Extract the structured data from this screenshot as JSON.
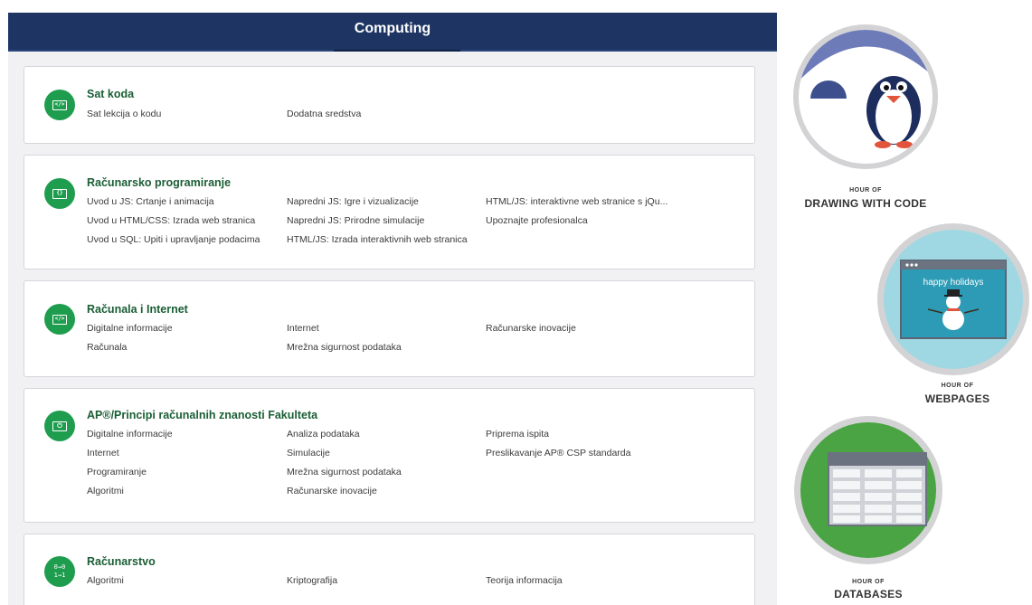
{
  "header": {
    "title": "Computing"
  },
  "cards": [
    {
      "title": "Sat koda",
      "icon": "code-window-icon",
      "links": [
        "Sat lekcija o kodu",
        "Dodatna sredstva"
      ]
    },
    {
      "title": "Računarsko programiranje",
      "icon": "braces-window-icon",
      "links": [
        "Uvod u JS: Crtanje i animacija",
        "Napredni JS: Igre i vizualizacije",
        "HTML/JS: interaktivne web stranice s jQu...",
        "Uvod u HTML/CSS: Izrada web stranica",
        "Napredni JS: Prirodne simulacije",
        "Upoznajte profesionalca",
        "Uvod u SQL: Upiti i upravljanje podacima",
        "HTML/JS: Izrada interaktivnih web stranica"
      ]
    },
    {
      "title": "Računala i Internet",
      "icon": "code-window-icon",
      "links": [
        "Digitalne informacije",
        "Internet",
        "Računarske inovacije",
        "Računala",
        "Mrežna sigurnost podataka"
      ]
    },
    {
      "title": "AP®/Principi računalnih znanosti Fakulteta",
      "icon": "power-window-icon",
      "links": [
        "Digitalne informacije",
        "Analiza podataka",
        "Priprema ispita",
        "Internet",
        "Simulacije",
        "Preslikavanje AP® CSP standarda",
        "Programiranje",
        "Mrežna sigurnost podataka",
        "Algoritmi",
        "Računarske inovacije"
      ]
    },
    {
      "title": "Računarstvo",
      "icon": "binary-icon",
      "links": [
        "Algoritmi",
        "Kriptografija",
        "Teorija informacija"
      ]
    }
  ],
  "badges": [
    {
      "small": "HOUR OF",
      "big": "DRAWING WITH CODE",
      "icon": "penguin-icon"
    },
    {
      "small": "HOUR OF",
      "big": "WEBPAGES",
      "icon": "snowman-webpage-icon",
      "screen_text": "happy holidays"
    },
    {
      "small": "HOUR OF",
      "big": "DATABASES",
      "icon": "database-table-icon"
    }
  ],
  "icons": {
    "code": "</>",
    "braces": "{}",
    "binary_top": "0→0",
    "binary_bottom": "1→1"
  },
  "colors": {
    "header": "#1e3563",
    "accent_green": "#1f9d4f",
    "title_green": "#1a5e35"
  }
}
